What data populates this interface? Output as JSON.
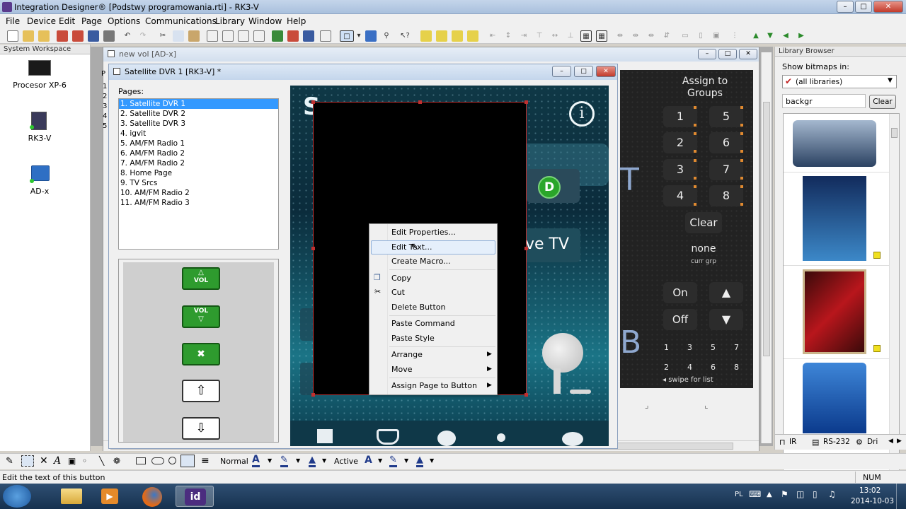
{
  "window": {
    "title": "Integration Designer® [Podstwy programowania.rti] - RK3-V"
  },
  "menu": [
    "File",
    "Device",
    "Edit",
    "Page",
    "Options",
    "Communications",
    "Library",
    "Window",
    "Help"
  ],
  "workspace": {
    "header": "System Workspace",
    "items": [
      "Procesor XP-6",
      "RK3-V",
      "AD-x"
    ]
  },
  "mdi": {
    "title": "new vol [AD-x]",
    "side_letter": "P",
    "side_numbers": [
      "1",
      "2",
      "3",
      "4",
      "5"
    ]
  },
  "dialog": {
    "title": "Satellite DVR 1 [RK3-V] *",
    "pages_label": "Pages:",
    "pages": [
      "1. Satellite DVR 1",
      "2. Satellite DVR 2",
      "3. Satellite DVR 3",
      "4. igvit",
      "5. AM/FM Radio 1",
      "6. AM/FM Radio 2",
      "7. AM/FM Radio 2",
      "8. Home Page",
      "9. TV Srcs",
      "10. AM/FM Radio 2",
      "11. AM/FM Radio 3"
    ],
    "vol_up": "VOL",
    "vol_down": "VOL"
  },
  "remote": {
    "d_label": "D",
    "tv_label": "ve TV",
    "big_letter_t": "T",
    "big_letter_b": "B",
    "big_letter_s": "S",
    "info_glyph": "i"
  },
  "dark_panel": {
    "title": "Assign to Groups",
    "keys_left": [
      "1",
      "2",
      "3",
      "4"
    ],
    "keys_right": [
      "5",
      "6",
      "7",
      "8"
    ],
    "clear": "Clear",
    "none": "none",
    "curr": "curr grp",
    "on": "On",
    "off": "Off",
    "small_row1": [
      "1",
      "3",
      "5",
      "7"
    ],
    "small_row2": [
      "2",
      "4",
      "6",
      "8"
    ],
    "swipe": "◂ swipe for list"
  },
  "context_menu": {
    "items": [
      "Edit Properties...",
      "Edit Text...",
      "Create Macro...",
      "Copy",
      "Cut",
      "Delete Button",
      "Paste Command",
      "Paste Style",
      "Arrange",
      "Move",
      "Assign Page to Button"
    ]
  },
  "library": {
    "header": "Library Browser",
    "show_label": "Show bitmaps in:",
    "select_value": "(all libraries)",
    "search_value": "backgr",
    "clear_label": "Clear",
    "tabs": [
      "IR",
      "RS-232",
      "Dri"
    ]
  },
  "bottom_toolbar": {
    "style_label": "Normal",
    "active_label": "Active"
  },
  "status": {
    "text": "Edit the text of this button",
    "num": "NUM"
  },
  "taskbar": {
    "lang": "PL",
    "time": "13:02",
    "date": "2014-10-03"
  }
}
